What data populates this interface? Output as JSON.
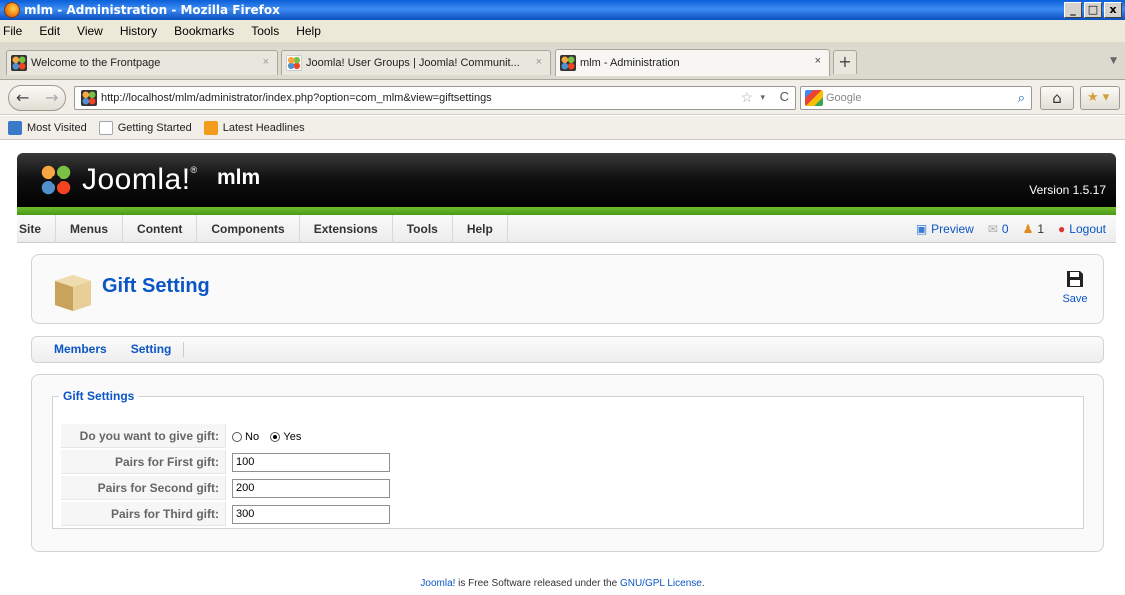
{
  "window": {
    "title": "mlm - Administration - Mozilla Firefox",
    "controls": [
      "_",
      "□",
      "x"
    ]
  },
  "menubar": [
    "File",
    "Edit",
    "View",
    "History",
    "Bookmarks",
    "Tools",
    "Help"
  ],
  "tabs": [
    {
      "label": "Welcome to the Frontpage",
      "close": "×"
    },
    {
      "label": "Joomla! User Groups | Joomla! Communit...",
      "close": "×"
    },
    {
      "label": "mlm - Administration",
      "close": "×"
    }
  ],
  "new_tab": "+",
  "nav": {
    "back": "←",
    "forward": "→",
    "url": "http://localhost/mlm/administrator/index.php?option=com_mlm&view=giftsettings",
    "star": "☆",
    "dropdown": "▾",
    "reload": "C",
    "search_engine": "Google",
    "search_icon": "⌕",
    "home": "⌂",
    "addon": "★ ▾"
  },
  "bookmarks": [
    "Most Visited",
    "Getting Started",
    "Latest Headlines"
  ],
  "joomla": {
    "brand": "Joomla!",
    "trademark": "®",
    "site_name": "mlm",
    "version": "Version 1.5.17"
  },
  "admin_menu": [
    "Site",
    "Menus",
    "Content",
    "Components",
    "Extensions",
    "Tools",
    "Help"
  ],
  "status": {
    "preview": "Preview",
    "messages": "0",
    "users": "1",
    "logout": "Logout"
  },
  "toolbar": {
    "title": "Gift Setting",
    "save": "Save"
  },
  "submenu": [
    "Members",
    "Setting"
  ],
  "form": {
    "legend": "Gift Settings",
    "give_gift_label": "Do you want to give gift:",
    "option_no": "No",
    "option_yes": "Yes",
    "selected": "Yes",
    "first_label": "Pairs for First gift:",
    "first_value": "100",
    "second_label": "Pairs for Second gift:",
    "second_value": "200",
    "third_label": "Pairs for Third gift:",
    "third_value": "300"
  },
  "footer": {
    "brand": "Joomla!",
    "text": " is Free Software released under the ",
    "license": "GNU/GPL License",
    "end": "."
  },
  "icons": {
    "app": "firefox-icon",
    "favicon": "joomla-icon",
    "page": "box-icon",
    "save": "floppy-disk-icon",
    "preview": "preview-icon",
    "messages": "message-icon",
    "users": "users-icon",
    "logout": "logout-icon"
  },
  "colors": {
    "title_bar": "#0a5fd8",
    "joomla_link": "#0b55c4",
    "joomla_green": "#6fbd2e",
    "header_dark": "#111111"
  }
}
